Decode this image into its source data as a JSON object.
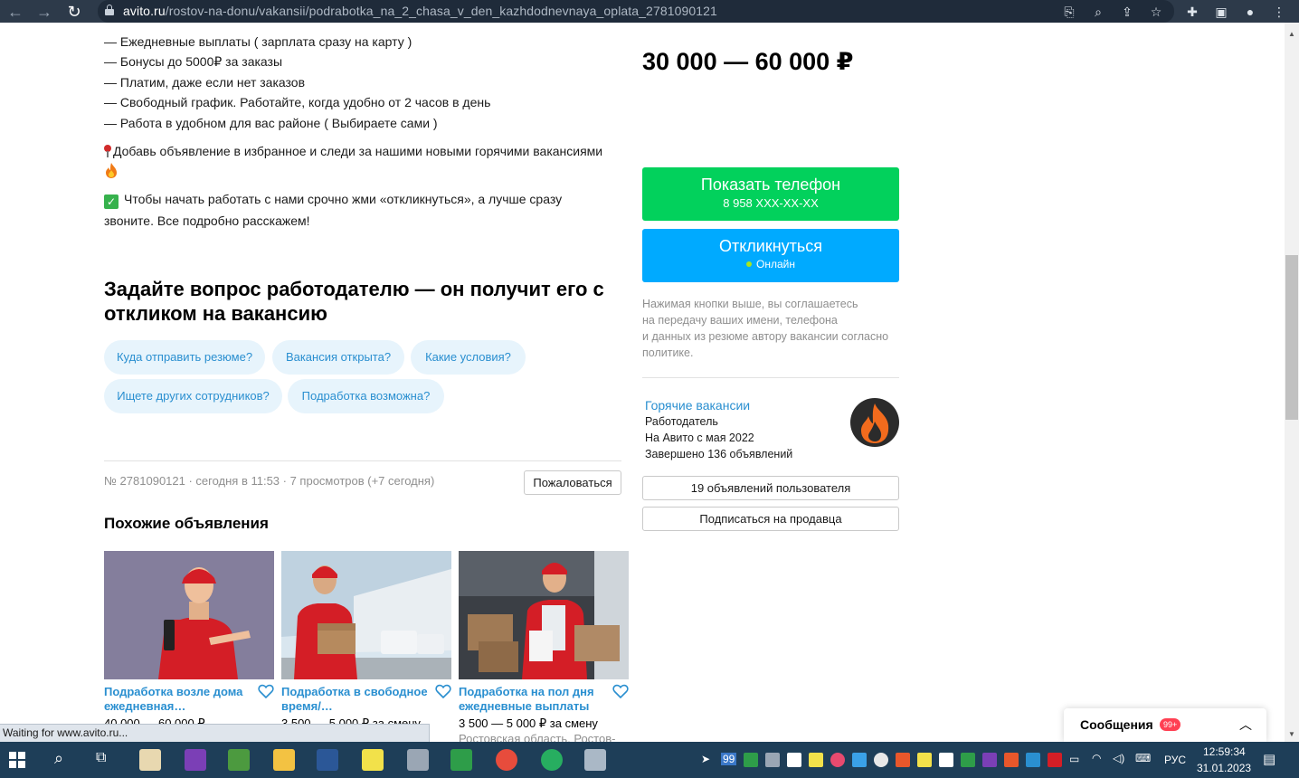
{
  "browser": {
    "url_host": "avito.ru",
    "url_path": "/rostov-na-donu/vakansii/podrabotka_na_2_chasa_v_den_kazhdodnevnaya_oplata_2781090121"
  },
  "description": {
    "lines": [
      "— Ежедневные выплаты ( зарплата сразу на карту )",
      "— Бонусы до 5000₽ за заказы",
      "— Платим, даже если нет заказов",
      "— Свободный график. Работайте, когда удобно от 2 часов в день",
      "— Работа в удобном для вас районе ( Выбираете сами )"
    ],
    "favorite_note": "Добавь объявление в избранное и следи за нашими новыми горячими вакансиями",
    "call_note_1": "Чтобы начать работать с нами срочно жми «откликнуться», а лучше сразу",
    "call_note_2": "звоните. Все подробно расскажем!"
  },
  "ask": {
    "title": "Задайте вопрос работодателю — он получит его с откликом на вакансию",
    "chips": [
      "Куда отправить резюме?",
      "Вакансия открыта?",
      "Какие условия?",
      "Ищете других сотрудников?",
      "Подработка возможна?"
    ]
  },
  "meta": {
    "text": "№ 2781090121 · сегодня в 11:53 · 7 просмотров (+7 сегодня)",
    "report_label": "Пожаловаться"
  },
  "similar": {
    "title": "Похожие объявления",
    "cards": [
      {
        "title": "Подработка возле дома ежедневная…",
        "price": "40 000 — 60 000 ₽",
        "location": ""
      },
      {
        "title": "Подработка в свободное время/…",
        "price": "3 500 — 5 000 ₽ за смену",
        "location": ""
      },
      {
        "title": "Подработка на пол дня ежедневные выплаты",
        "price": "3 500 — 5 000 ₽ за смену",
        "location": "Ростовская область, Ростов-"
      }
    ]
  },
  "sidebar": {
    "salary": "30 000 — 60 000 ₽",
    "phone_button": "Показать телефон",
    "phone_masked": "8 958 XXX-XX-XX",
    "reply_button": "Откликнуться",
    "online_label": "Онлайн",
    "consent": [
      "Нажимая кнопки выше, вы соглашаетесь",
      "на передачу ваших имени, телефона",
      "и данных из резюме автору вакансии согласно",
      "политике."
    ],
    "seller_name": "Горячие вакансии",
    "seller_role": "Работодатель",
    "seller_since": "На Авито с мая 2022",
    "seller_completed": "Завершено 136 объявлений",
    "seller_ads_button": "19 объявлений пользователя",
    "subscribe_button": "Подписаться на продавца"
  },
  "messages": {
    "label": "Сообщения",
    "badge": "99+"
  },
  "status_bar": "Waiting for www.avito.ru...",
  "taskbar": {
    "tray_count": "99",
    "lang": "РУС",
    "time": "12:59:34",
    "date": "31.01.2023"
  },
  "colors": {
    "green_button": "#02d15c",
    "blue_button": "#00aaff",
    "link": "#2a8fd0",
    "chip_bg": "#e7f4fc"
  }
}
